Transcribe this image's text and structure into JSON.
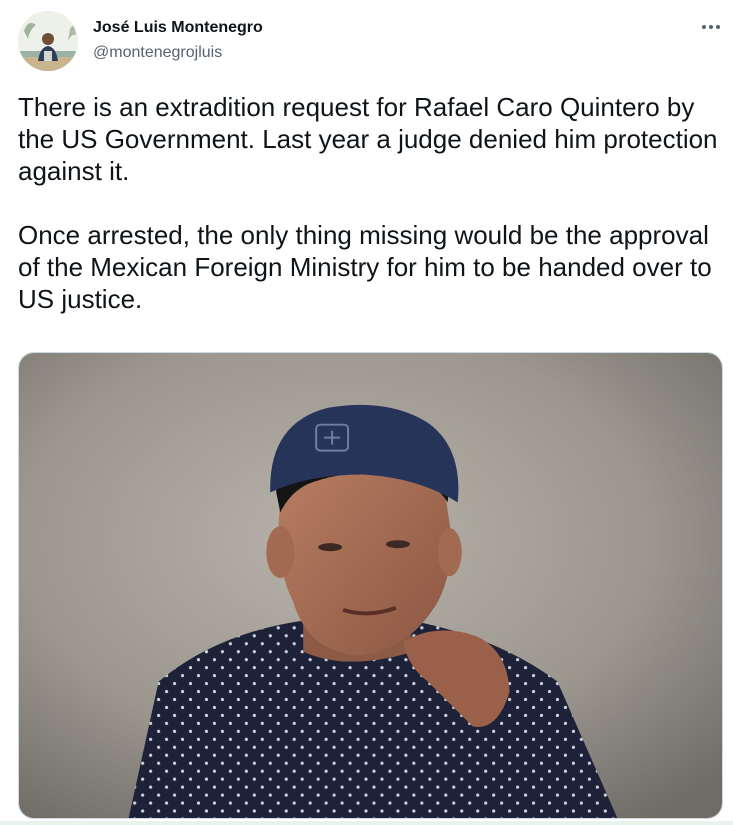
{
  "author": {
    "name": "José Luis Montenegro",
    "handle": "@montenegrojluis",
    "avatar_icon": "user-avatar"
  },
  "menu": {
    "icon": "more-horizontal-icon"
  },
  "tweet": {
    "paragraphs": [
      "There is an extradition request for Rafael Caro Quintero by the US Government. Last year a judge denied him protection against it.",
      "Once arrested, the only thing missing would be the approval of the Mexican Foreign Ministry for him to be handed over to US justice."
    ]
  },
  "media": {
    "type": "photo",
    "subject": "person-photo"
  },
  "colors": {
    "text": "#0f1419",
    "secondary": "#536471",
    "border": "#cfd9de"
  }
}
